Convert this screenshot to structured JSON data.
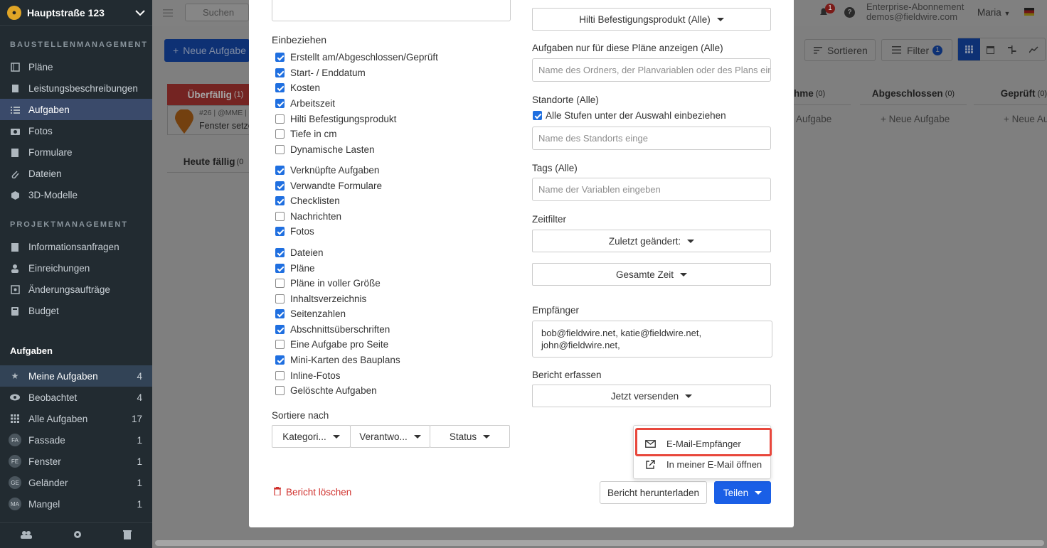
{
  "project": {
    "name": "Hauptstraße 123"
  },
  "topbar": {
    "search_placeholder": "Suchen",
    "notifications_count": "1",
    "plan_name": "Enterprise-Abonnement",
    "user_email": "demos@fieldwire.com",
    "user_name": "Maria"
  },
  "sidebar": {
    "section1_title": "BAUSTELLENMANAGEMENT",
    "section1_items": [
      {
        "label": "Pläne",
        "icon": "plans-icon"
      },
      {
        "label": "Leistungsbeschreibungen",
        "icon": "specs-icon"
      },
      {
        "label": "Aufgaben",
        "icon": "list-icon"
      },
      {
        "label": "Fotos",
        "icon": "camera-icon"
      },
      {
        "label": "Formulare",
        "icon": "clipboard-icon"
      },
      {
        "label": "Dateien",
        "icon": "paperclip-icon"
      },
      {
        "label": "3D-Modelle",
        "icon": "cube-icon"
      }
    ],
    "section2_title": "PROJEKTMANAGEMENT",
    "section2_items": [
      {
        "label": "Informationsanfragen",
        "icon": "file-icon"
      },
      {
        "label": "Einreichungen",
        "icon": "person-icon"
      },
      {
        "label": "Änderungsaufträge",
        "icon": "change-icon"
      },
      {
        "label": "Budget",
        "icon": "calculator-icon"
      }
    ],
    "tasks_title": "Aufgaben",
    "task_items": [
      {
        "label": "Meine Aufgaben",
        "count": "4",
        "icon": "star-icon"
      },
      {
        "label": "Beobachtet",
        "count": "4",
        "icon": "eye-icon"
      },
      {
        "label": "Alle Aufgaben",
        "count": "17",
        "icon": "grid-icon"
      },
      {
        "label": "Fassade",
        "count": "1",
        "badge": "FA"
      },
      {
        "label": "Fenster",
        "count": "1",
        "badge": "FE"
      },
      {
        "label": "Geländer",
        "count": "1",
        "badge": "GE"
      },
      {
        "label": "Mangel",
        "count": "1",
        "badge": "MA"
      }
    ]
  },
  "background": {
    "new_task_button": "Neue Aufgabe",
    "sort_button": "Sortieren",
    "filter_button": "Filter",
    "filter_count": "1",
    "col_overdue": "Überfällig",
    "col_overdue_count": "(1)",
    "card_meta": "#26 | @MME |",
    "card_title": "Fenster setze",
    "col_today": "Heute fällig",
    "col_today_count": "(0",
    "col_accept": "hme",
    "col_accept_count": "(0)",
    "col_done": "Abgeschlossen",
    "col_done_count": "(0)",
    "col_checked": "Geprüft",
    "col_checked_count": "(0)",
    "new_task_link_partial": "Aufgabe",
    "new_task_link": "+ Neue Aufgabe",
    "new_task_link_cut": "+ Neue Aufg"
  },
  "modal": {
    "include_title": "Einbeziehen",
    "checkboxes": [
      {
        "label": "Erstellt am/Abgeschlossen/Geprüft",
        "checked": true
      },
      {
        "label": "Start- / Enddatum",
        "checked": true
      },
      {
        "label": "Kosten",
        "checked": true
      },
      {
        "label": "Arbeitszeit",
        "checked": true
      },
      {
        "label": "Hilti Befestigungsprodukt",
        "checked": false
      },
      {
        "label": "Tiefe in cm",
        "checked": false
      },
      {
        "label": "Dynamische Lasten",
        "checked": false
      },
      {
        "label": "Verknüpfte Aufgaben",
        "checked": true
      },
      {
        "label": "Verwandte Formulare",
        "checked": true
      },
      {
        "label": "Checklisten",
        "checked": true
      },
      {
        "label": "Nachrichten",
        "checked": false
      },
      {
        "label": "Fotos",
        "checked": true
      },
      {
        "label": "Dateien",
        "checked": true
      },
      {
        "label": "Pläne",
        "checked": true
      },
      {
        "label": "Pläne in voller Größe",
        "checked": false
      },
      {
        "label": "Inhaltsverzeichnis",
        "checked": false
      },
      {
        "label": "Seitenzahlen",
        "checked": true
      },
      {
        "label": "Abschnittsüberschriften",
        "checked": true
      },
      {
        "label": "Eine Aufgabe pro Seite",
        "checked": false
      },
      {
        "label": "Mini-Karten des Bauplans",
        "checked": true
      },
      {
        "label": "Inline-Fotos",
        "checked": false
      },
      {
        "label": "Gelöschte Aufgaben",
        "checked": false
      }
    ],
    "sort_title": "Sortiere nach",
    "sort_options": [
      "Kategori...",
      "Verantwo...",
      "Status"
    ],
    "hilti_dropdown": "Hilti Befestigungsprodukt (Alle)",
    "plans_label": "Aufgaben nur für diese Pläne anzeigen (Alle)",
    "plans_placeholder": "Name des Ordners, der Planvariablen oder des Plans einge",
    "locations_label": "Standorte (Alle)",
    "include_sublevels": "Alle Stufen unter der Auswahl einbeziehen",
    "location_placeholder": "Name des Standorts einge",
    "tags_label": "Tags (Alle)",
    "tags_placeholder": "Name der Variablen eingeben",
    "time_filter_label": "Zeitfilter",
    "time_filter_type": "Zuletzt geändert:",
    "time_range": "Gesamte Zeit",
    "recipients_label": "Empfänger",
    "recipients_line1": "bob@fieldwire.net, katie@fieldwire.net,",
    "recipients_line2": "john@fieldwire.net,",
    "capture_label": "Bericht erfassen",
    "capture_value": "Jetzt versenden",
    "delete_report": "Bericht löschen",
    "download_report": "Bericht herunterladen",
    "share_button": "Teilen",
    "share_menu": [
      {
        "label": "E-Mail-Empfänger",
        "icon": "envelope-icon"
      },
      {
        "label": "In meiner E-Mail öffnen",
        "icon": "external-link-icon"
      }
    ]
  },
  "colors": {
    "primary": "#1a5fe6",
    "danger": "#d0312d",
    "highlight": "#e8473c",
    "sidebar_bg": "#222b31",
    "overdue": "#e8473c"
  }
}
